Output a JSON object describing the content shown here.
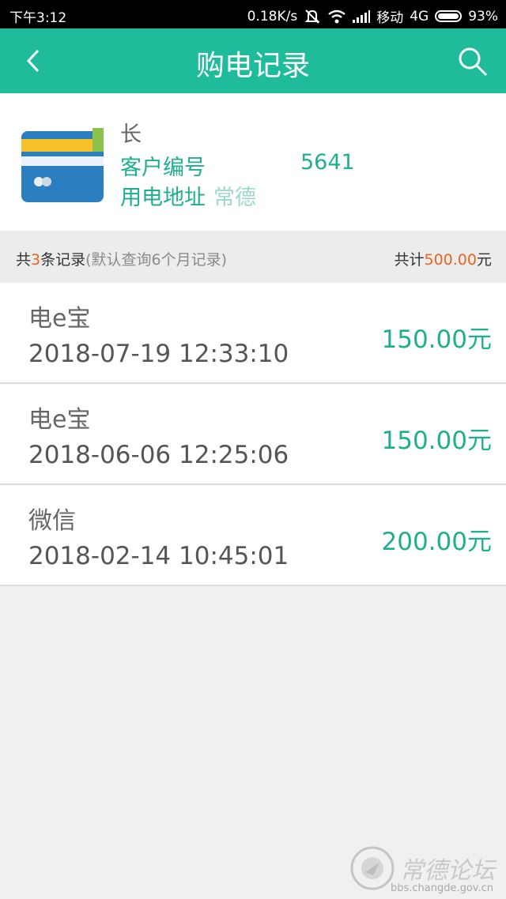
{
  "status_bar": {
    "time": "下午3:12",
    "speed": "0.18K/s",
    "carrier": "移动",
    "network": "4G",
    "battery": "93%",
    "icons": [
      "mute-icon",
      "wifi-icon",
      "signal-icon",
      "battery-icon"
    ]
  },
  "header": {
    "title": "购电记录",
    "back_icon": "back-arrow-icon",
    "search_icon": "search-icon"
  },
  "account": {
    "name": "长",
    "customer_label": "客户编号",
    "customer_tail": "5641",
    "address_label": "用电地址",
    "address_text": "常德"
  },
  "summary": {
    "prefix": "共",
    "count": "3",
    "suffix": "条记录",
    "note": "(默认查询6个月记录)",
    "total_label": "共计",
    "total_value": "500.00",
    "total_unit": "元"
  },
  "records": [
    {
      "method": "电e宝",
      "time": "2018-07-19 12:33:10",
      "amount": "150.00元"
    },
    {
      "method": "电e宝",
      "time": "2018-06-06 12:25:06",
      "amount": "150.00元"
    },
    {
      "method": "微信",
      "time": "2018-02-14 10:45:01",
      "amount": "200.00元"
    }
  ],
  "watermark": {
    "text": "常德论坛",
    "url": "bbs.changde.gov.cn"
  },
  "colors": {
    "accent": "#1fbc9c",
    "amount": "#1fae8e",
    "highlight": "#e8641f"
  }
}
